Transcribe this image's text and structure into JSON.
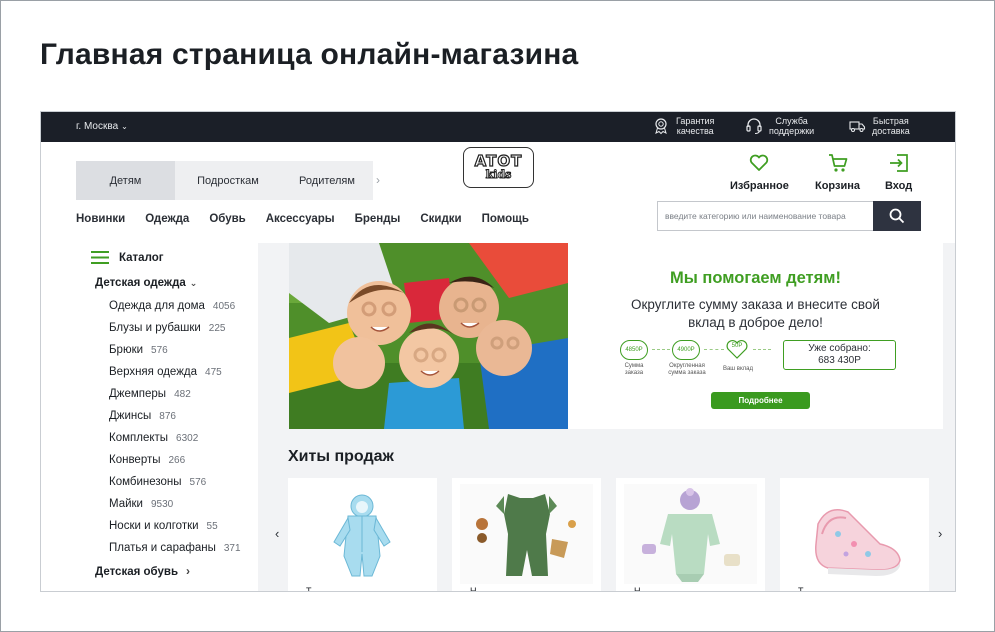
{
  "heading": "Главная страница онлайн-магазина",
  "topbar": {
    "city": "г. Москва",
    "features": [
      {
        "icon": "quality-badge-icon",
        "line1": "Гарантия",
        "line2": "качества"
      },
      {
        "icon": "headset-icon",
        "line1": "Служба",
        "line2": "поддержки"
      },
      {
        "icon": "delivery-truck-icon",
        "line1": "Быстрая",
        "line2": "доставка"
      }
    ]
  },
  "segments": [
    "Детям",
    "Подросткам",
    "Родителям"
  ],
  "logo": {
    "top": "ATOT",
    "bottom": "kids"
  },
  "header_actions": [
    {
      "icon": "heart-icon",
      "label": "Избранное"
    },
    {
      "icon": "cart-icon",
      "label": "Корзина"
    },
    {
      "icon": "login-icon",
      "label": "Вход"
    }
  ],
  "nav": [
    "Новинки",
    "Одежда",
    "Обувь",
    "Аксессуары",
    "Бренды",
    "Скидки",
    "Помощь"
  ],
  "search": {
    "placeholder": "введите категорию или наименование товара"
  },
  "sidebar": {
    "catalog_label": "Каталог",
    "group1": "Детская одежда",
    "items": [
      {
        "label": "Одежда для дома",
        "count": "4056"
      },
      {
        "label": "Блузы и рубашки",
        "count": "225"
      },
      {
        "label": "Брюки",
        "count": "576"
      },
      {
        "label": "Верхняя одежда",
        "count": "475"
      },
      {
        "label": "Джемперы",
        "count": "482"
      },
      {
        "label": "Джинсы",
        "count": "876"
      },
      {
        "label": "Комплекты",
        "count": "6302"
      },
      {
        "label": "Конверты",
        "count": "266"
      },
      {
        "label": "Комбинезоны",
        "count": "576"
      },
      {
        "label": "Майки",
        "count": "9530"
      },
      {
        "label": "Носки и колготки",
        "count": "55"
      },
      {
        "label": "Платья и сарафаны",
        "count": "371"
      }
    ],
    "group2": "Детская обувь"
  },
  "banner": {
    "title": "Мы помогаем детям!",
    "subtitle_line1": "Округлите сумму заказа и внесите свой",
    "subtitle_line2": "вклад в доброе дело!",
    "step1_value": "4850Р",
    "step1_label_line1": "Сумма",
    "step1_label_line2": "заказа",
    "step2_value": "4900Р",
    "step2_label_line1": "Округленная",
    "step2_label_line2": "сумма заказа",
    "step3_value": "50Р",
    "step3_label": "Ваш вклад",
    "collected_label": "Уже собрано:",
    "collected_value": "683 430Р",
    "button": "Подробнее",
    "accent_color": "#3f9e22"
  },
  "hits": {
    "title": "Хиты продаж",
    "products": [
      {
        "image": "blue-snowsuit",
        "name": "Т"
      },
      {
        "image": "green-romper-with-accessories",
        "name": "Н"
      },
      {
        "image": "knit-baby-set",
        "name": "Н"
      },
      {
        "image": "pink-floral-baby-shoe",
        "name": "Т"
      }
    ]
  },
  "colors": {
    "topbar": "#1b1f28",
    "accent": "#3f9e22",
    "search_button": "#2e3340"
  }
}
